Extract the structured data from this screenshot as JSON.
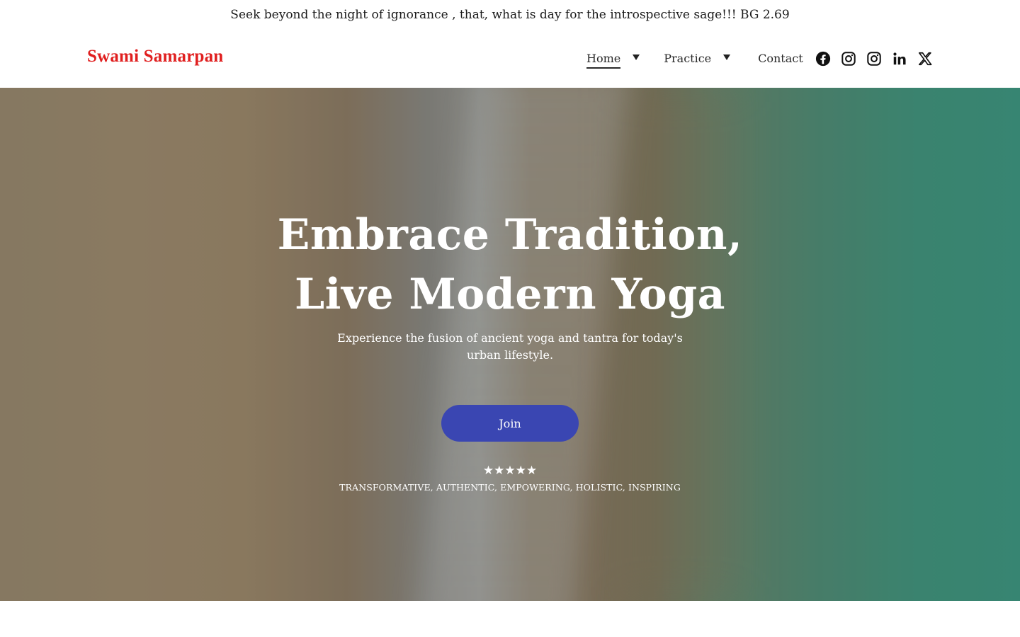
{
  "announcement": {
    "text": "Seek beyond the night of ignorance , that, what is day for the introspective sage!!! BG 2.69"
  },
  "header": {
    "brand": "Swami Samarpan",
    "brand_color": "#e01f1f",
    "nav": {
      "home": "Home",
      "practice": "Practice",
      "contact": "Contact"
    },
    "socials": [
      "facebook-icon",
      "instagram-icon",
      "instagram-icon",
      "linkedin-icon",
      "x-twitter-icon"
    ]
  },
  "hero": {
    "title_line1": "Embrace Tradition,",
    "title_line2": "Live Modern Yoga",
    "subtitle": "Experience the fusion of ancient yoga and tantra for today's urban lifestyle.",
    "cta_label": "Join",
    "cta_color": "#3a46b2",
    "stars": "★★★★★",
    "rating": 5,
    "tagline": "TRANSFORMATIVE, AUTHENTIC, EMPOWERING, HOLISTIC, INSPIRING"
  }
}
